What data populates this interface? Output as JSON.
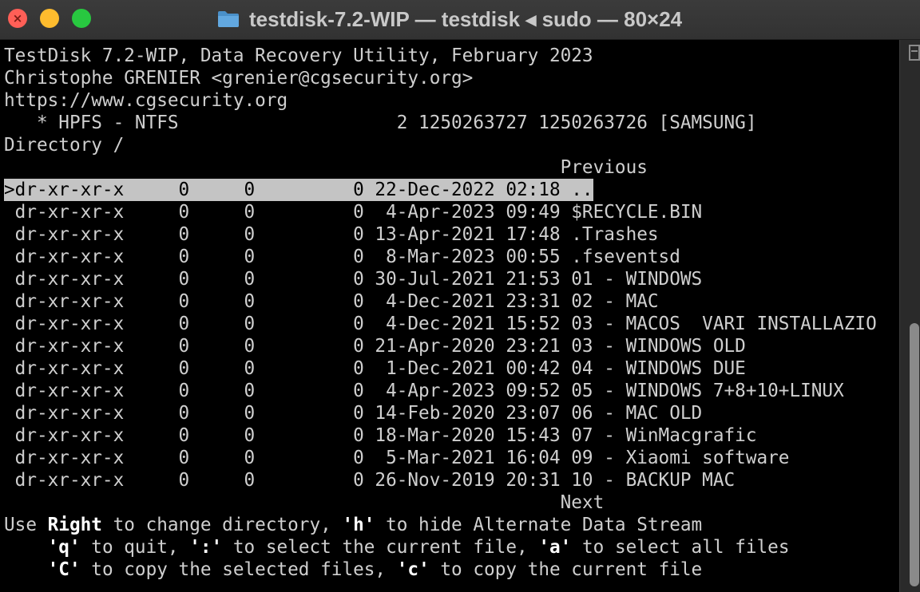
{
  "window": {
    "title": "testdisk-7.2-WIP — testdisk ◂ sudo — 80×24",
    "close_glyph": "×",
    "colors": {
      "close": "#ff5f57",
      "minimize": "#febc2e",
      "maximize": "#28c840"
    }
  },
  "terminal": {
    "header": [
      "TestDisk 7.2-WIP, Data Recovery Utility, February 2023",
      "Christophe GRENIER <grenier@cgsecurity.org>",
      "https://www.cgsecurity.org",
      "   * HPFS - NTFS                    2 1250263727 1250263726 [SAMSUNG]",
      "Directory /"
    ],
    "previous_label": "                                                   Previous",
    "rows": [
      ">dr-xr-xr-x     0     0         0 22-Dec-2022 02:18 ..",
      " dr-xr-xr-x     0     0         0  4-Apr-2023 09:49 $RECYCLE.BIN",
      " dr-xr-xr-x     0     0         0 13-Apr-2021 17:48 .Trashes",
      " dr-xr-xr-x     0     0         0  8-Mar-2023 00:55 .fseventsd",
      " dr-xr-xr-x     0     0         0 30-Jul-2021 21:53 01 - WINDOWS",
      " dr-xr-xr-x     0     0         0  4-Dec-2021 23:31 02 - MAC",
      " dr-xr-xr-x     0     0         0  4-Dec-2021 15:52 03 - MACOS  VARI INSTALLAZIO",
      " dr-xr-xr-x     0     0         0 21-Apr-2020 23:21 03 - WINDOWS OLD",
      " dr-xr-xr-x     0     0         0  1-Dec-2021 00:42 04 - WINDOWS DUE",
      " dr-xr-xr-x     0     0         0  4-Apr-2023 09:52 05 - WINDOWS 7+8+10+LINUX",
      " dr-xr-xr-x     0     0         0 14-Feb-2020 23:07 06 - MAC OLD",
      " dr-xr-xr-x     0     0         0 18-Mar-2020 15:43 07 - WinMacgrafic",
      " dr-xr-xr-x     0     0         0  5-Mar-2021 16:04 09 - Xiaomi software",
      " dr-xr-xr-x     0     0         0 26-Nov-2019 20:31 10 - BACKUP MAC"
    ],
    "next_label": "                                                   Next",
    "help": {
      "l1_a": "Use ",
      "l1_k1": "Right",
      "l1_b": " to change directory, ",
      "l1_k2": "'h'",
      "l1_c": " to hide Alternate Data Stream",
      "l2_a": "    ",
      "l2_k1": "'q'",
      "l2_b": " to quit, ",
      "l2_k2": "':'",
      "l2_c": " to select the current file, ",
      "l2_k3": "'a'",
      "l2_d": " to select all files",
      "l3_a": "    ",
      "l3_k1": "'C'",
      "l3_b": " to copy the selected files, ",
      "l3_k2": "'c'",
      "l3_c": " to copy the current file"
    }
  }
}
